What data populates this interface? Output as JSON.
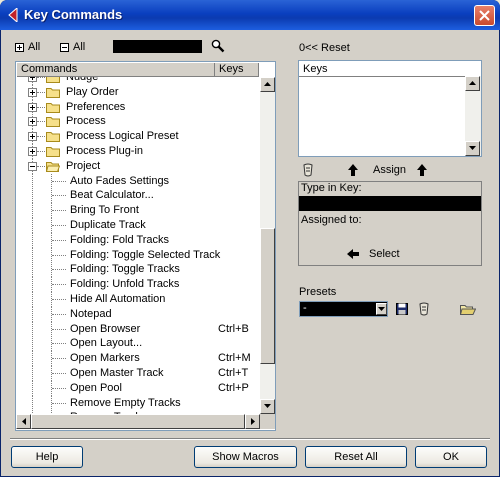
{
  "window": {
    "title": "Key Commands"
  },
  "toolbar": {
    "expand_all": "All",
    "collapse_all": "All"
  },
  "tree": {
    "columns": {
      "commands": "Commands",
      "keys": "Keys"
    },
    "rows": [
      {
        "label": "Nudge",
        "keys": "",
        "type": "folder"
      },
      {
        "label": "Play Order",
        "keys": "",
        "type": "folder"
      },
      {
        "label": "Preferences",
        "keys": "",
        "type": "folder"
      },
      {
        "label": "Process",
        "keys": "",
        "type": "folder"
      },
      {
        "label": "Process Logical Preset",
        "keys": "",
        "type": "folder"
      },
      {
        "label": "Process Plug-in",
        "keys": "",
        "type": "folder"
      },
      {
        "label": "Project",
        "keys": "",
        "type": "folder-open"
      },
      {
        "label": "Auto Fades Settings",
        "keys": "",
        "type": "item"
      },
      {
        "label": "Beat Calculator...",
        "keys": "",
        "type": "item"
      },
      {
        "label": "Bring To Front",
        "keys": "",
        "type": "item"
      },
      {
        "label": "Duplicate Track",
        "keys": "",
        "type": "item"
      },
      {
        "label": "Folding: Fold Tracks",
        "keys": "",
        "type": "item"
      },
      {
        "label": "Folding: Toggle Selected Track",
        "keys": "",
        "type": "item"
      },
      {
        "label": "Folding: Toggle Tracks",
        "keys": "",
        "type": "item"
      },
      {
        "label": "Folding: Unfold Tracks",
        "keys": "",
        "type": "item"
      },
      {
        "label": "Hide All Automation",
        "keys": "",
        "type": "item"
      },
      {
        "label": "Notepad",
        "keys": "",
        "type": "item"
      },
      {
        "label": "Open Browser",
        "keys": "Ctrl+B",
        "type": "item"
      },
      {
        "label": "Open Layout...",
        "keys": "",
        "type": "item"
      },
      {
        "label": "Open Markers",
        "keys": "Ctrl+M",
        "type": "item"
      },
      {
        "label": "Open Master Track",
        "keys": "Ctrl+T",
        "type": "item"
      },
      {
        "label": "Open Pool",
        "keys": "Ctrl+P",
        "type": "item"
      },
      {
        "label": "Remove Empty Tracks",
        "keys": "",
        "type": "item"
      },
      {
        "label": "Remove Track",
        "keys": "",
        "type": "item"
      }
    ]
  },
  "right": {
    "reset": "0<< Reset",
    "keys_header": "Keys",
    "assign": "Assign",
    "type_in_key": "Type in Key:",
    "assigned_to": "Assigned to:",
    "select": "Select",
    "presets_label": "Presets",
    "preset_value": "-"
  },
  "buttons": {
    "help": "Help",
    "show_macros": "Show Macros",
    "reset_all": "Reset All",
    "ok": "OK"
  }
}
